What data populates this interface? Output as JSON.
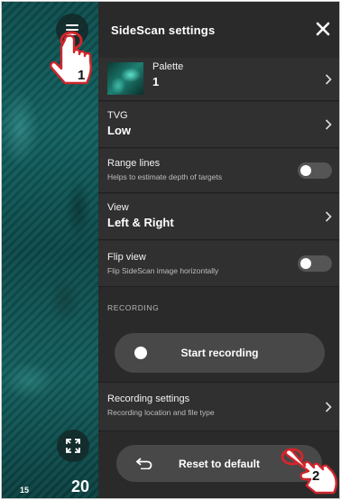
{
  "sonar": {
    "range_small": "15",
    "range_big": "20",
    "menu_icon": "hamburger-icon",
    "expand_icon": "expand-icon"
  },
  "callouts": {
    "step1": "1",
    "step2": "2"
  },
  "panel": {
    "title": "SideScan settings",
    "close_icon": "close-icon",
    "palette": {
      "label": "Palette",
      "value": "1"
    },
    "tvg": {
      "label": "TVG",
      "value": "Low"
    },
    "range_lines": {
      "label": "Range lines",
      "description": "Helps to estimate depth of targets",
      "enabled": false
    },
    "view": {
      "label": "View",
      "value": "Left & Right"
    },
    "flip_view": {
      "label": "Flip view",
      "description": "Flip SideScan image horizontally",
      "enabled": false
    },
    "recording_section": "RECORDING",
    "start_recording": "Start recording",
    "recording_settings": {
      "label": "Recording settings",
      "description": "Recording location and file type"
    },
    "reset": "Reset to default"
  },
  "colors": {
    "panel_bg": "#2a2a2a",
    "row_bg": "#303030",
    "pill_bg": "#484848",
    "callout_red": "#d0262c",
    "sonar_teal": "#136262"
  }
}
